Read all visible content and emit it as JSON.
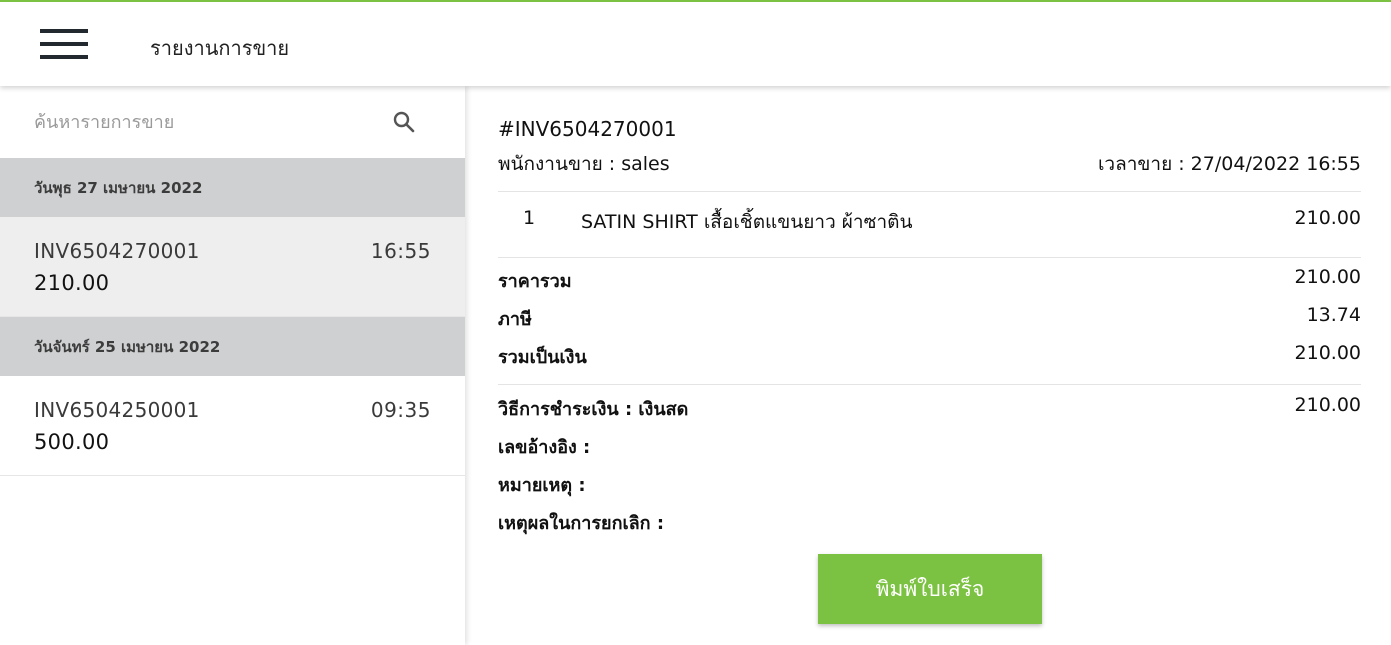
{
  "header": {
    "title": "รายงานการขาย",
    "accent_color": "#7cc242",
    "menu_icon": "hamburger-menu-icon"
  },
  "sidebar": {
    "search": {
      "placeholder": "ค้นหารายการขาย",
      "icon": "search-icon"
    },
    "groups": [
      {
        "date_label": "วันพุธ 27 เมษายน 2022",
        "sales": [
          {
            "invoice": "INV6504270001",
            "time": "16:55",
            "amount": "210.00"
          }
        ]
      },
      {
        "date_label": "วันจันทร์ 25 เมษายน 2022",
        "sales": [
          {
            "invoice": "INV6504250001",
            "time": "09:35",
            "amount": "500.00"
          }
        ]
      }
    ]
  },
  "detail": {
    "invoice_number": "#INV6504270001",
    "salesperson": "พนักงานขาย : sales",
    "sale_time": "เวลาขาย : 27/04/2022 16:55",
    "items": [
      {
        "qty": "1",
        "name": "SATIN SHIRT เสื้อเชิ้ตแขนยาว ผ้าซาติน",
        "price": "210.00"
      }
    ],
    "summary": {
      "subtotal_label": "ราคารวม",
      "subtotal_value": "210.00",
      "tax_label": "ภาษี",
      "tax_value": "13.74",
      "total_label": "รวมเป็นเงิน",
      "total_value": "210.00"
    },
    "payment": {
      "method_label": "วิธีการชำระเงิน : เงินสด",
      "method_value": "210.00",
      "reference_label": "เลขอ้างอิง :",
      "note_label": "หมายเหตุ :",
      "cancel_reason_label": "เหตุผลในการยกเลิก :"
    },
    "print_button": "พิมพ์ใบเสร็จ"
  }
}
